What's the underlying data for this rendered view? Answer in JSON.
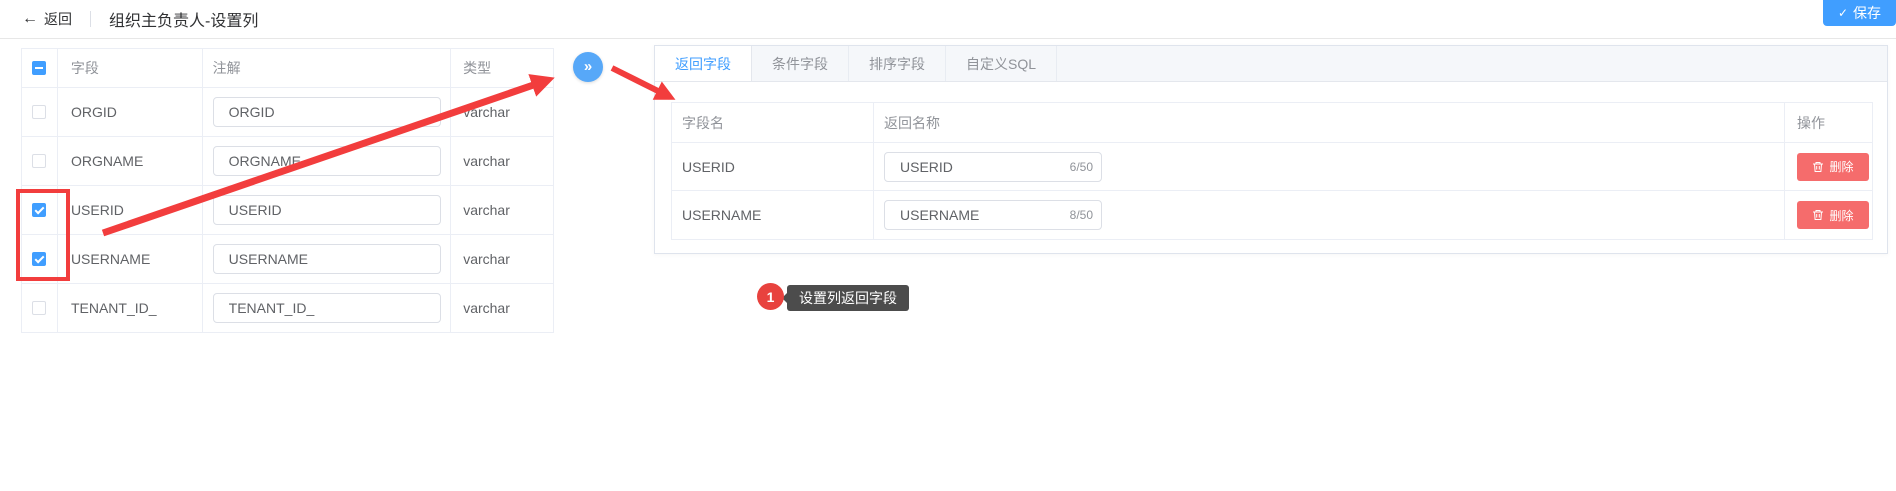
{
  "colors": {
    "accent_blue": "#409eff",
    "transfer_blue": "#57a8f8",
    "danger_red": "#f56c6c",
    "annotation_red": "#f23d3d",
    "tooltip_bg": "#4c4c4c"
  },
  "topbar": {
    "back_icon": "←",
    "back_label": "返回",
    "title": "组织主负责人-设置列",
    "save_icon": "✓",
    "save_label": "保存"
  },
  "left_table": {
    "header_checkbox_indeterminate": true,
    "headers": {
      "field": "字段",
      "comment": "注解",
      "type": "类型"
    },
    "rows": [
      {
        "field": "ORGID",
        "comment": "ORGID",
        "type": "varchar",
        "checked": false
      },
      {
        "field": "ORGNAME",
        "comment": "ORGNAME",
        "type": "varchar",
        "checked": false
      },
      {
        "field": "USERID",
        "comment": "USERID",
        "type": "varchar",
        "checked": true
      },
      {
        "field": "USERNAME",
        "comment": "USERNAME",
        "type": "varchar",
        "checked": true
      },
      {
        "field": "TENANT_ID_",
        "comment": "TENANT_ID_",
        "type": "varchar",
        "checked": false
      }
    ]
  },
  "transfer_button": {
    "icon": "»"
  },
  "right_panel": {
    "tabs": [
      {
        "label": "返回字段",
        "active": true
      },
      {
        "label": "条件字段",
        "active": false
      },
      {
        "label": "排序字段",
        "active": false
      },
      {
        "label": "自定义SQL",
        "active": false
      }
    ],
    "table": {
      "headers": {
        "field_name": "字段名",
        "return_name": "返回名称",
        "operation": "操作"
      },
      "rows": [
        {
          "field_name": "USERID",
          "return_name": "USERID",
          "counter": "6/50",
          "delete_label": "删除"
        },
        {
          "field_name": "USERNAME",
          "return_name": "USERNAME",
          "counter": "8/50",
          "delete_label": "删除"
        }
      ]
    }
  },
  "annotation": {
    "step": "1",
    "tooltip": "设置列返回字段"
  }
}
